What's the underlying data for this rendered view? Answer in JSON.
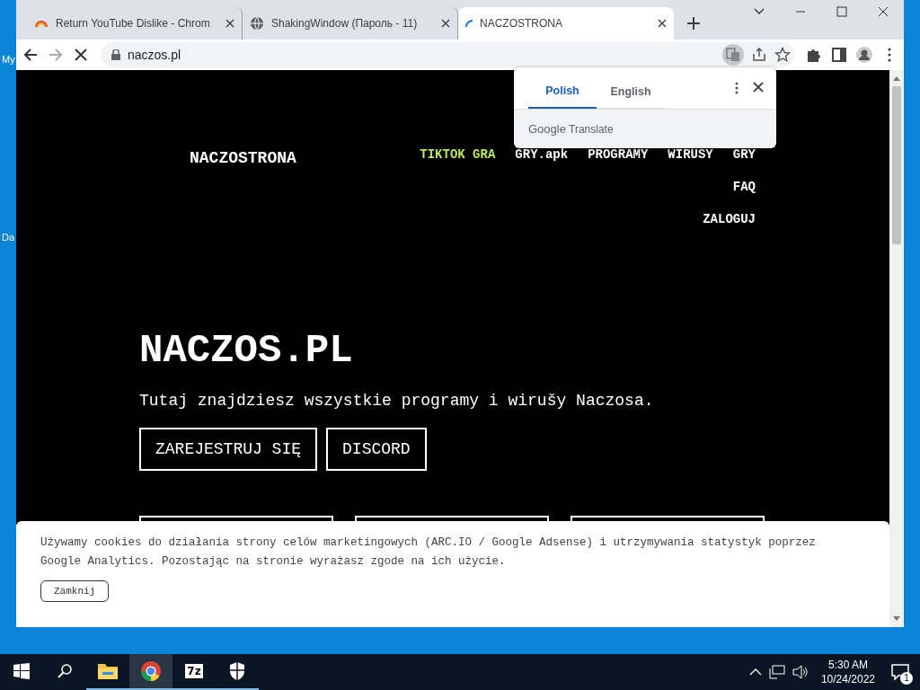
{
  "desktop": {
    "icon_labels": [
      "My",
      "Da"
    ]
  },
  "browser": {
    "tabs": [
      {
        "kind": "extension",
        "title": "Return YouTube Dislike - Chrom",
        "selected": false
      },
      {
        "kind": "globe",
        "title": "ShakingWindow (Пароль - 11)",
        "selected": false
      },
      {
        "kind": "loading",
        "title": "NACZOSTRONA",
        "selected": true
      }
    ],
    "address": "naczos.pl"
  },
  "translate_popup": {
    "tabs": [
      {
        "label": "Polish",
        "selected": true
      },
      {
        "label": "English",
        "selected": false
      }
    ],
    "brand": "Google",
    "product": "Translate"
  },
  "page": {
    "logo": "NACZOSTRONA",
    "nav_lines": [
      [
        {
          "label": "TIKTOK GRA",
          "hovered": true
        },
        {
          "label": "GRY.apk",
          "hovered": false
        },
        {
          "label": "PROGRAMY",
          "hovered": false
        },
        {
          "label": "WIRUSY",
          "hovered": false
        },
        {
          "label": "GRY",
          "hovered": false
        }
      ],
      [
        {
          "label": "FAQ",
          "hovered": false
        }
      ],
      [
        {
          "label": "ZALOGUJ",
          "hovered": false
        }
      ]
    ],
    "title": "NACZOS.PL",
    "subtitle": "Tutaj znajdziesz wszystkie programy i wirušy Naczosa.",
    "buttons": [
      "ZAREJESTRUJ SIĘ",
      "DISCORD"
    ]
  },
  "cookie_banner": {
    "text": "Używamy cookies do działania strony celów marketingowych (ARC.IO / Google Adsense) i utrzymywania statystyk poprzez Google Analytics. Pozostając na stronie wyrażasz zgode na ich użycie.",
    "button": "Zamknij"
  },
  "taskbar": {
    "apps": [
      {
        "kind": "folder",
        "active": false
      },
      {
        "kind": "chrome",
        "active": true
      },
      {
        "kind": "archiver",
        "label": "7z",
        "active": false
      },
      {
        "kind": "shield",
        "active": false
      }
    ],
    "time": "5:30 AM",
    "date": "10/24/2022",
    "notification_count": "1"
  }
}
